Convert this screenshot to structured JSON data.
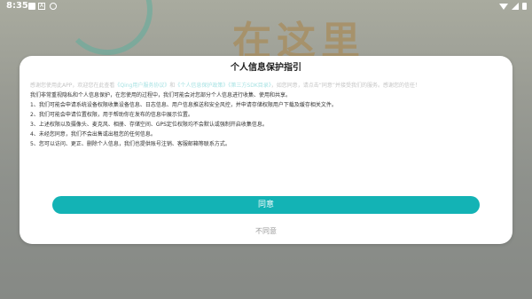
{
  "status_bar": {
    "time": "8:35",
    "icons": [
      "photo-icon",
      "notification-a-icon",
      "circle-icon",
      "wifi-icon",
      "signal-icon",
      "battery-icon"
    ]
  },
  "background": {
    "headline": "在这里"
  },
  "dialog": {
    "title": "个人信息保护指引",
    "intro_faded": {
      "prefix": "感谢您使用此APP，欢迎您在此查看",
      "link_user_agreement": "《Qing用户服务协议》",
      "and": "和",
      "link_privacy": "《个人信息保护政策》",
      "link_sdk": "《第三方SDK目录》",
      "suffix": "，如您同意，请点击“同意”并接受我们的服务。感谢您的信任！"
    },
    "paragraphs": [
      "我们非常重视隐私和个人信息保护，在您使用的过程中，我们可能会对您部分个人信息进行收集、使用和共享。",
      "1、我们可能会申请系统设备权限收集设备信息、日志信息、用户信息推送和安全风控，并申请存储权限用户下载及缓存相关文件。",
      "2、我们可能会申请位置权限，用于帮助你在发布的信息中展示位置。",
      "3、上述权限以及摄像头、麦克风、相册、存储空间、GPS定位权限均不会默认或强制开启收集信息。",
      "4、未经您同意，我们不会出售或出租您的任何信息。",
      "5、您可以访问、更正、删除个人信息，我们也提供账号注销、客服邮箱等联系方式。"
    ],
    "agree_label": "同意",
    "disagree_label": "不同意"
  },
  "colors": {
    "accent": "#13b3b5",
    "link_faded": "#a7e2e3"
  }
}
